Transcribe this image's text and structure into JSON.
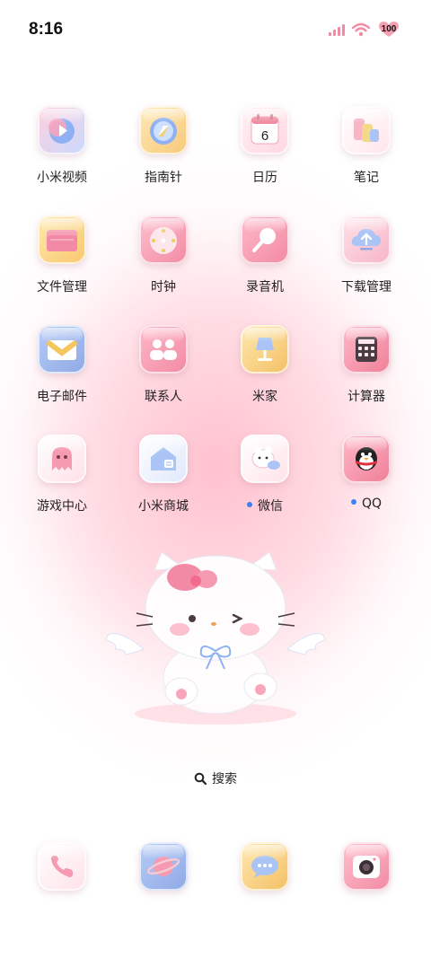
{
  "status_bar": {
    "time": "8:16",
    "battery": "100",
    "icons": [
      "signal-icon",
      "wifi-icon",
      "battery-heart-icon"
    ]
  },
  "apps": [
    {
      "label": "小米视频",
      "icon": "video-icon",
      "badge": false
    },
    {
      "label": "指南针",
      "icon": "compass-icon",
      "badge": false
    },
    {
      "label": "日历",
      "icon": "calendar-icon",
      "badge": false,
      "icon_text": "6"
    },
    {
      "label": "笔记",
      "icon": "notes-icon",
      "badge": false
    },
    {
      "label": "文件管理",
      "icon": "folder-icon",
      "badge": false
    },
    {
      "label": "时钟",
      "icon": "clock-icon",
      "badge": false
    },
    {
      "label": "录音机",
      "icon": "microphone-icon",
      "badge": false
    },
    {
      "label": "下载管理",
      "icon": "download-cloud-icon",
      "badge": false
    },
    {
      "label": "电子邮件",
      "icon": "mail-icon",
      "badge": false
    },
    {
      "label": "联系人",
      "icon": "contacts-icon",
      "badge": false
    },
    {
      "label": "米家",
      "icon": "smart-home-lamp-icon",
      "badge": false
    },
    {
      "label": "计算器",
      "icon": "calculator-icon",
      "badge": false
    },
    {
      "label": "游戏中心",
      "icon": "ghost-game-icon",
      "badge": false
    },
    {
      "label": "小米商城",
      "icon": "shop-icon",
      "badge": false
    },
    {
      "label": "微信",
      "icon": "wechat-icon",
      "badge": true
    },
    {
      "label": "QQ",
      "icon": "qq-penguin-icon",
      "badge": true
    }
  ],
  "search": {
    "label": "搜索"
  },
  "dock": [
    {
      "icon": "phone-icon"
    },
    {
      "icon": "browser-planet-icon"
    },
    {
      "icon": "messages-icon"
    },
    {
      "icon": "camera-icon"
    }
  ],
  "colors": {
    "wallpaper_pink": "#ffc3d0",
    "badge_dot": "#3b82f6",
    "signal": "#f28aa3"
  }
}
